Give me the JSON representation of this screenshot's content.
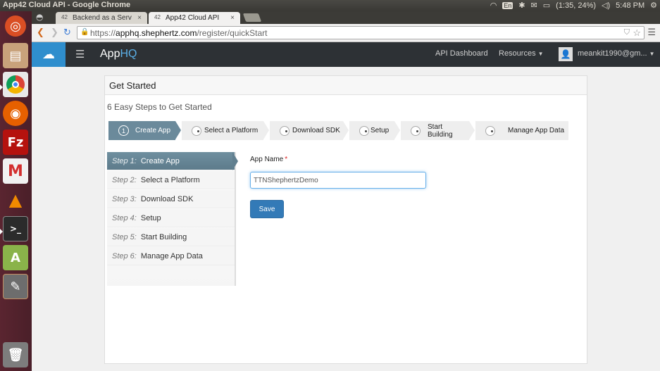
{
  "system": {
    "window_title": "App42 Cloud API - Google Chrome",
    "keyboard": "En",
    "battery": "(1:35, 24%)",
    "time": "5:48 PM"
  },
  "browser": {
    "tabs": [
      {
        "label": "Backend as a Service",
        "favicon": "42"
      },
      {
        "label": "App42 Cloud API",
        "favicon": "42"
      }
    ],
    "url_scheme": "https://",
    "url_host": "apphq.shephertz.com",
    "url_path": "/register/quickStart"
  },
  "app": {
    "brand_prefix": "App",
    "brand_suffix": "HQ",
    "nav_api_dashboard": "API Dashboard",
    "nav_resources": "Resources",
    "user": "meankit1990@gm...",
    "card_title": "Get Started",
    "subtitle": "6 Easy Steps to Get Started",
    "active_step_number": "1",
    "steps": [
      {
        "label": "Create App"
      },
      {
        "label": "Select a Platform"
      },
      {
        "label": "Download SDK"
      },
      {
        "label": "Setup"
      },
      {
        "label": "Start Building"
      },
      {
        "label": "Manage App Data"
      }
    ],
    "side_steps": [
      {
        "prefix": "Step 1:",
        "label": "Create App"
      },
      {
        "prefix": "Step 2:",
        "label": "Select a Platform"
      },
      {
        "prefix": "Step 3:",
        "label": "Download SDK"
      },
      {
        "prefix": "Step 4:",
        "label": "Setup"
      },
      {
        "prefix": "Step 5:",
        "label": "Start Building"
      },
      {
        "prefix": "Step 6:",
        "label": "Manage App Data"
      }
    ],
    "form": {
      "app_name_label": "App Name",
      "required_mark": "*",
      "app_name_value": "TTNShephertzDemo",
      "save_label": "Save"
    }
  },
  "colors": {
    "accent": "#6b8a9b",
    "primary_button": "#337ab7",
    "appbar": "#2d3135",
    "logo": "#2f8ecd"
  }
}
